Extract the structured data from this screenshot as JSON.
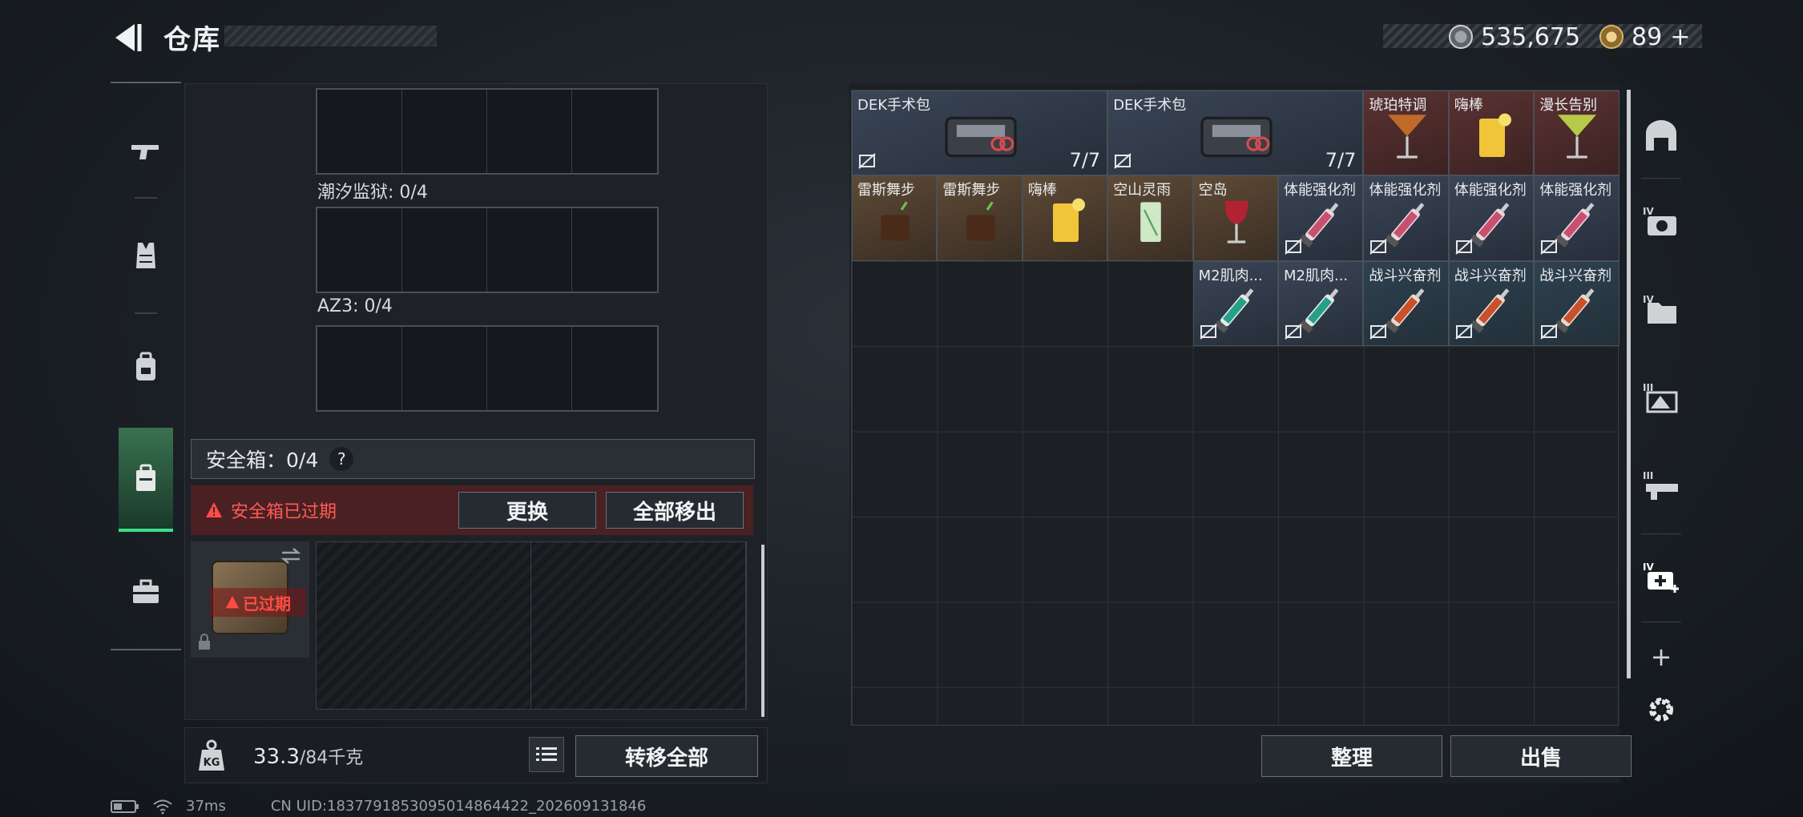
{
  "header": {
    "title": "仓库",
    "currency": {
      "silver": "535,675",
      "gold": "89"
    },
    "gold_add": "+"
  },
  "left_nav": [
    {
      "name": "weapon"
    },
    {
      "name": "armor"
    },
    {
      "name": "backpack"
    },
    {
      "name": "safebox"
    },
    {
      "name": "toolbox"
    }
  ],
  "equip_slots": [
    {
      "label": "潮汐监狱: 0/4"
    },
    {
      "label": "AZ3: 0/4"
    }
  ],
  "safebox": {
    "label": "安全箱：0/4",
    "help": "?",
    "expired_msg": "安全箱已过期",
    "replace_btn": "更换",
    "remove_all_btn": "全部移出",
    "case_expired": "已过期"
  },
  "weight": {
    "current": "33.3",
    "max": "/84千克",
    "transfer_all_btn": "转移全部"
  },
  "storage": {
    "items": [
      {
        "name": "DEK手术包",
        "count": "7/7",
        "quality": "q-blue",
        "col": 0,
        "row": 0,
        "w": 3,
        "h": 1,
        "icon": "medkit"
      },
      {
        "name": "DEK手术包",
        "count": "7/7",
        "quality": "q-blue",
        "col": 3,
        "row": 0,
        "w": 3,
        "h": 1,
        "icon": "medkit"
      },
      {
        "name": "琥珀特调",
        "quality": "q-red",
        "col": 6,
        "row": 0,
        "w": 1,
        "h": 1,
        "icon": "cocktail-amber"
      },
      {
        "name": "嗨棒",
        "quality": "q-red",
        "col": 7,
        "row": 0,
        "w": 1,
        "h": 1,
        "icon": "highball"
      },
      {
        "name": "漫长告别",
        "quality": "q-red",
        "col": 8,
        "row": 0,
        "w": 1,
        "h": 1,
        "icon": "cocktail-green"
      },
      {
        "name": "雷斯舞步",
        "quality": "q-brown",
        "col": 0,
        "row": 1,
        "w": 1,
        "h": 1,
        "icon": "old-fashioned"
      },
      {
        "name": "雷斯舞步",
        "quality": "q-brown",
        "col": 1,
        "row": 1,
        "w": 1,
        "h": 1,
        "icon": "old-fashioned"
      },
      {
        "name": "嗨棒",
        "quality": "q-brown",
        "col": 2,
        "row": 1,
        "w": 1,
        "h": 1,
        "icon": "highball"
      },
      {
        "name": "空山灵雨",
        "quality": "q-brown",
        "col": 3,
        "row": 1,
        "w": 1,
        "h": 1,
        "icon": "mojito"
      },
      {
        "name": "空岛",
        "quality": "q-brown",
        "col": 4,
        "row": 1,
        "w": 1,
        "h": 1,
        "icon": "wine"
      },
      {
        "name": "体能强化剂",
        "quality": "q-blue",
        "col": 5,
        "row": 1,
        "w": 1,
        "h": 1,
        "icon": "syringe-pink",
        "locked": true
      },
      {
        "name": "体能强化剂",
        "quality": "q-blue",
        "col": 6,
        "row": 1,
        "w": 1,
        "h": 1,
        "icon": "syringe-pink",
        "locked": true
      },
      {
        "name": "体能强化剂",
        "quality": "q-blue",
        "col": 7,
        "row": 1,
        "w": 1,
        "h": 1,
        "icon": "syringe-pink",
        "locked": true
      },
      {
        "name": "体能强化剂",
        "quality": "q-blue",
        "col": 8,
        "row": 1,
        "w": 1,
        "h": 1,
        "icon": "syringe-pink",
        "locked": true
      },
      {
        "name": "M2肌肉...",
        "quality": "q-blue",
        "col": 4,
        "row": 2,
        "w": 1,
        "h": 1,
        "icon": "syringe-teal",
        "locked": true
      },
      {
        "name": "M2肌肉...",
        "quality": "q-blue",
        "col": 5,
        "row": 2,
        "w": 1,
        "h": 1,
        "icon": "syringe-teal",
        "locked": true
      },
      {
        "name": "战斗兴奋剂",
        "quality": "q-steel",
        "col": 6,
        "row": 2,
        "w": 1,
        "h": 1,
        "icon": "syringe-red",
        "locked": true
      },
      {
        "name": "战斗兴奋剂",
        "quality": "q-steel",
        "col": 7,
        "row": 2,
        "w": 1,
        "h": 1,
        "icon": "syringe-red",
        "locked": true
      },
      {
        "name": "战斗兴奋剂",
        "quality": "q-steel",
        "col": 8,
        "row": 2,
        "w": 1,
        "h": 1,
        "icon": "syringe-red",
        "locked": true
      }
    ],
    "sort_btn": "整理",
    "sell_btn": "出售"
  },
  "right_nav": [
    {
      "name": "vault-icon"
    },
    {
      "name": "tier4-camera-icon"
    },
    {
      "name": "tier4-folder-icon"
    },
    {
      "name": "tier3-artifact-icon"
    },
    {
      "name": "tier3-weapon-icon"
    },
    {
      "name": "tier4-medical-icon"
    },
    {
      "name": "add-icon",
      "label": "+"
    },
    {
      "name": "settings-icon"
    }
  ],
  "status": {
    "ping": "37ms",
    "uid": "CN UID:1837791853095014864422_202609131846"
  }
}
